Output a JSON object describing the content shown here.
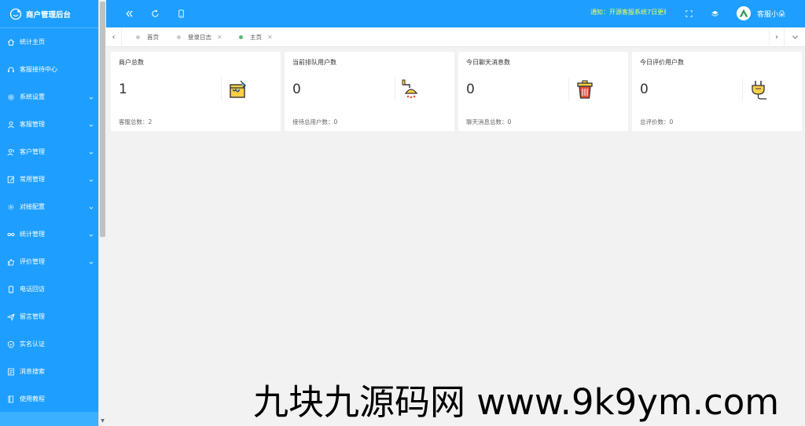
{
  "app": {
    "title": "商户管理后台"
  },
  "sidebar": {
    "items": [
      {
        "label": "统计主页",
        "icon": "home-icon",
        "has_children": false
      },
      {
        "label": "客服接待中心",
        "icon": "headset-icon",
        "has_children": false
      },
      {
        "label": "系统设置",
        "icon": "gear-icon",
        "has_children": true
      },
      {
        "label": "客服管理",
        "icon": "user-icon",
        "has_children": true
      },
      {
        "label": "客户管理",
        "icon": "users-icon",
        "has_children": true
      },
      {
        "label": "常用管理",
        "icon": "edit-icon",
        "has_children": true
      },
      {
        "label": "对接配置",
        "icon": "settings-icon",
        "has_children": true
      },
      {
        "label": "统计管理",
        "icon": "infinity-icon",
        "has_children": true
      },
      {
        "label": "评价管理",
        "icon": "thumb-up-icon",
        "has_children": true
      },
      {
        "label": "电话回访",
        "icon": "phone-icon",
        "has_children": false
      },
      {
        "label": "留言管理",
        "icon": "send-icon",
        "has_children": false
      },
      {
        "label": "实名认证",
        "icon": "shield-check-icon",
        "has_children": false
      },
      {
        "label": "消息搜索",
        "icon": "document-search-icon",
        "has_children": false
      },
      {
        "label": "使用教程",
        "icon": "book-icon",
        "has_children": false
      }
    ]
  },
  "header": {
    "notice": "通知：开源客服系统7日更新",
    "user_name": "客服小朵"
  },
  "tabs": [
    {
      "label": "首页",
      "active": false,
      "closable": false
    },
    {
      "label": "登录日志",
      "active": false,
      "closable": true
    },
    {
      "label": "主页",
      "active": true,
      "closable": true
    }
  ],
  "cards": [
    {
      "title": "商户总数",
      "value": "1",
      "footer": "客服总数：2",
      "icon": "paint-bucket-icon"
    },
    {
      "title": "当前排队用户数",
      "value": "0",
      "footer": "接待总用户数：0",
      "icon": "shower-icon"
    },
    {
      "title": "今日聊天消息数",
      "value": "0",
      "footer": "聊天消息总数：0",
      "icon": "trash-bin-icon"
    },
    {
      "title": "今日评价用户数",
      "value": "0",
      "footer": "总评价数：0",
      "icon": "plug-icon"
    }
  ],
  "watermark": "九块九源码网 www.9k9ym.com",
  "colors": {
    "primary": "#1e9fff",
    "notice": "#e8ff56",
    "active_dot": "#5fb878"
  }
}
